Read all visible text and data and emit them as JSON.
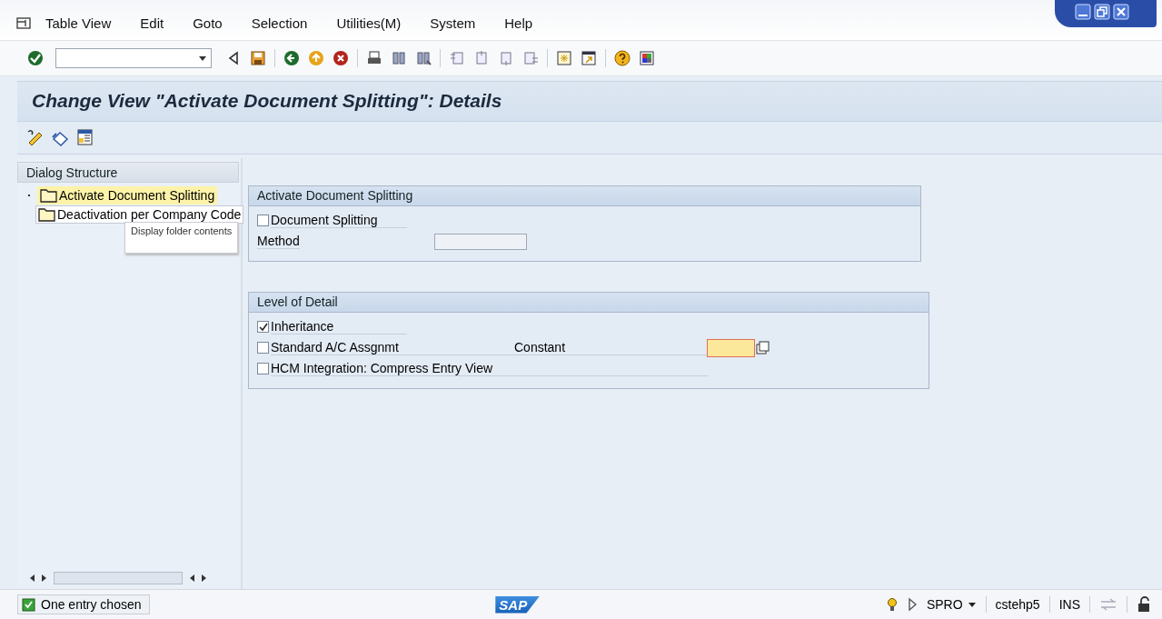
{
  "menu": [
    {
      "label": "Table View"
    },
    {
      "label": "Edit"
    },
    {
      "label": "Goto"
    },
    {
      "label": "Selection"
    },
    {
      "label": "Utilities(M)"
    },
    {
      "label": "System"
    },
    {
      "label": "Help"
    }
  ],
  "title": "Change View \"Activate Document Splitting\": Details",
  "dialog_structure": {
    "header": "Dialog Structure",
    "items": [
      {
        "label": "Activate Document Splitting",
        "selected": true
      },
      {
        "label": "Deactivation per Company Code",
        "selected": false
      }
    ],
    "tooltip": "Display folder contents"
  },
  "groups": [
    {
      "title": "Activate Document Splitting",
      "fields": [
        {
          "kind": "checkbox",
          "label": "Document Splitting",
          "checked": false
        },
        {
          "kind": "input",
          "label": "Method"
        }
      ]
    },
    {
      "title": "Level of Detail",
      "fields": [
        {
          "kind": "checkbox",
          "label": "Inheritance",
          "checked": true
        },
        {
          "kind": "checkbox",
          "label": "Standard A/C Assgnmt",
          "checked": false,
          "value": "Constant"
        },
        {
          "kind": "checkbox",
          "label": "HCM Integration: Compress Entry View",
          "checked": false
        }
      ]
    }
  ],
  "status_bar": {
    "message": "One entry chosen",
    "logo": "SAP",
    "transaction": "SPRO",
    "server": "cstehp5",
    "mode": "INS"
  }
}
